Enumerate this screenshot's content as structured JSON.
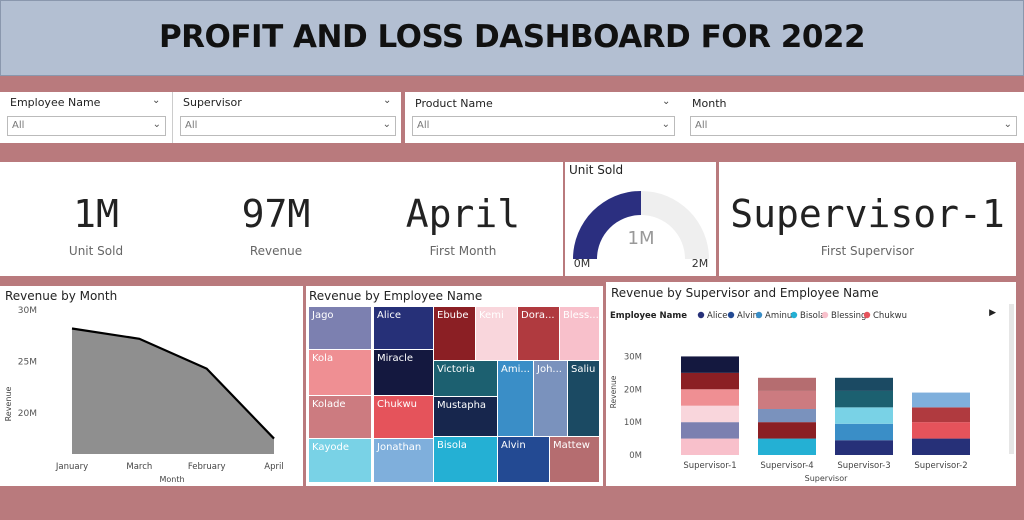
{
  "banner": {
    "title": "PROFIT AND LOSS DASHBOARD FOR 2022"
  },
  "slicers": [
    {
      "label": "Employee Name",
      "value": "All"
    },
    {
      "label": "Supervisor",
      "value": "All"
    },
    {
      "label": "Product Name",
      "value": "All"
    },
    {
      "label": "Month",
      "value": "All"
    }
  ],
  "kpis": [
    {
      "value": "1M",
      "label": "Unit Sold"
    },
    {
      "value": "97M",
      "label": "Revenue"
    },
    {
      "value": "April",
      "label": "First Month"
    },
    {
      "value": "Supervisor-1",
      "label": "First Supervisor"
    }
  ],
  "gauge": {
    "title": "Unit Sold",
    "value_label": "1M",
    "min_label": "0M",
    "max_label": "2M",
    "fill_fraction": 0.5,
    "color": "#2b2f80"
  },
  "chart_data": [
    {
      "type": "area",
      "title": "Revenue by Month",
      "xlabel": "Month",
      "ylabel": "Revenue",
      "categories": [
        "January",
        "March",
        "February",
        "April"
      ],
      "values": [
        28.2,
        27.2,
        24.3,
        17.5
      ],
      "y_ticks": [
        "20M",
        "25M",
        "30M"
      ],
      "ylim": [
        16,
        30
      ]
    },
    {
      "type": "treemap",
      "title": "Revenue by Employee Name",
      "tiles": [
        {
          "name": "Jago",
          "color": "#7c80b0"
        },
        {
          "name": "Alice",
          "color": "#263078"
        },
        {
          "name": "Ebube",
          "color": "#8b1f24"
        },
        {
          "name": "Kemi",
          "color": "#f9d6dc"
        },
        {
          "name": "Dora...",
          "color": "#b03a3f"
        },
        {
          "name": "Bless...",
          "color": "#f8c0cb"
        },
        {
          "name": "Kola",
          "color": "#ef8f93"
        },
        {
          "name": "Miracle",
          "color": "#14183f"
        },
        {
          "name": "Victoria",
          "color": "#1c6070"
        },
        {
          "name": "Ami...",
          "color": "#3a8ec7"
        },
        {
          "name": "Joh...",
          "color": "#7a92bd"
        },
        {
          "name": "Saliu",
          "color": "#1b4a63"
        },
        {
          "name": "Kolade",
          "color": "#cc7b80"
        },
        {
          "name": "Chukwu",
          "color": "#e5535b"
        },
        {
          "name": "Mustapha",
          "color": "#17264d"
        },
        {
          "name": "Kayode",
          "color": "#79d2e6"
        },
        {
          "name": "Jonathan",
          "color": "#7fafdc"
        },
        {
          "name": "Bisola",
          "color": "#24b0d4"
        },
        {
          "name": "Alvin",
          "color": "#234a93"
        },
        {
          "name": "Mattew",
          "color": "#b56d70"
        }
      ]
    },
    {
      "type": "bar",
      "stacked": true,
      "title": "Revenue by Supervisor and Employee Name",
      "legend_title": "Employee Name",
      "xlabel": "Supervisor",
      "ylabel": "Revenue",
      "y_ticks": [
        "0M",
        "10M",
        "20M",
        "30M"
      ],
      "ylim": [
        0,
        35
      ],
      "categories": [
        "Supervisor-1",
        "Supervisor-4",
        "Supervisor-3",
        "Supervisor-2"
      ],
      "legend": [
        {
          "name": "Alice",
          "color": "#263078"
        },
        {
          "name": "Alvin",
          "color": "#234a93"
        },
        {
          "name": "Aminu",
          "color": "#3a8ec7"
        },
        {
          "name": "Bisola",
          "color": "#24b0d4"
        },
        {
          "name": "Blessing",
          "color": "#f8c0cb"
        },
        {
          "name": "Chukwu",
          "color": "#e5535b"
        }
      ],
      "stacks": [
        [
          {
            "value": 5.0,
            "color": "#f8c0cb"
          },
          {
            "value": 5.0,
            "color": "#7c80b0"
          },
          {
            "value": 5.0,
            "color": "#f9d6dc"
          },
          {
            "value": 5.0,
            "color": "#ef8f93"
          },
          {
            "value": 5.0,
            "color": "#8b1f24"
          },
          {
            "value": 5.0,
            "color": "#14183f"
          }
        ],
        [
          {
            "value": 5.0,
            "color": "#24b0d4"
          },
          {
            "value": 5.0,
            "color": "#8b1f24"
          },
          {
            "value": 4.0,
            "color": "#7a92bd"
          },
          {
            "value": 5.5,
            "color": "#cc7b80"
          },
          {
            "value": 4.0,
            "color": "#b56d70"
          }
        ],
        [
          {
            "value": 4.5,
            "color": "#263078"
          },
          {
            "value": 5.0,
            "color": "#3a8ec7"
          },
          {
            "value": 5.0,
            "color": "#79d2e6"
          },
          {
            "value": 5.0,
            "color": "#1c6070"
          },
          {
            "value": 4.0,
            "color": "#1b4a63"
          }
        ],
        [
          {
            "value": 5.0,
            "color": "#263078"
          },
          {
            "value": 5.0,
            "color": "#e5535b"
          },
          {
            "value": 4.5,
            "color": "#b03a3f"
          },
          {
            "value": 4.5,
            "color": "#7fafdc"
          }
        ]
      ]
    }
  ]
}
